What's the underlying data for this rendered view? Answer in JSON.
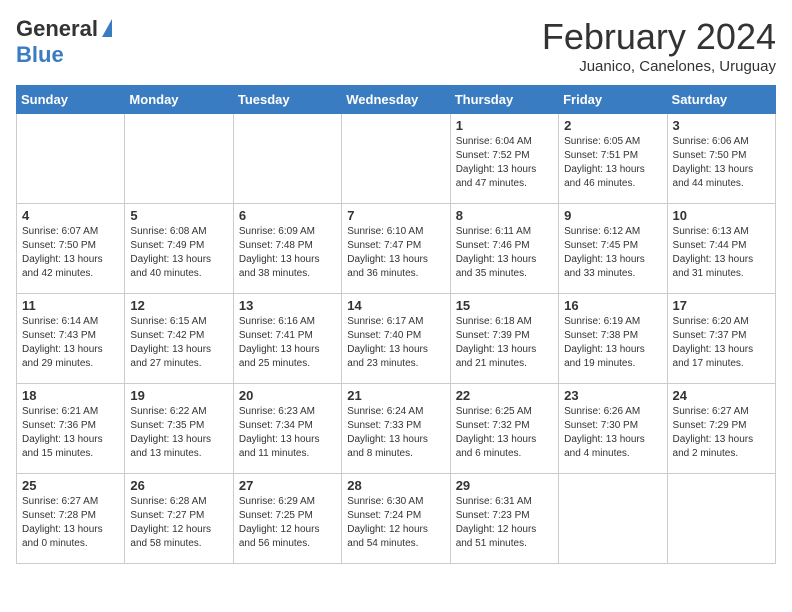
{
  "header": {
    "logo_general": "General",
    "logo_blue": "Blue",
    "month_title": "February 2024",
    "location": "Juanico, Canelones, Uruguay"
  },
  "weekdays": [
    "Sunday",
    "Monday",
    "Tuesday",
    "Wednesday",
    "Thursday",
    "Friday",
    "Saturday"
  ],
  "weeks": [
    [
      {
        "day": "",
        "info": ""
      },
      {
        "day": "",
        "info": ""
      },
      {
        "day": "",
        "info": ""
      },
      {
        "day": "",
        "info": ""
      },
      {
        "day": "1",
        "info": "Sunrise: 6:04 AM\nSunset: 7:52 PM\nDaylight: 13 hours\nand 47 minutes."
      },
      {
        "day": "2",
        "info": "Sunrise: 6:05 AM\nSunset: 7:51 PM\nDaylight: 13 hours\nand 46 minutes."
      },
      {
        "day": "3",
        "info": "Sunrise: 6:06 AM\nSunset: 7:50 PM\nDaylight: 13 hours\nand 44 minutes."
      }
    ],
    [
      {
        "day": "4",
        "info": "Sunrise: 6:07 AM\nSunset: 7:50 PM\nDaylight: 13 hours\nand 42 minutes."
      },
      {
        "day": "5",
        "info": "Sunrise: 6:08 AM\nSunset: 7:49 PM\nDaylight: 13 hours\nand 40 minutes."
      },
      {
        "day": "6",
        "info": "Sunrise: 6:09 AM\nSunset: 7:48 PM\nDaylight: 13 hours\nand 38 minutes."
      },
      {
        "day": "7",
        "info": "Sunrise: 6:10 AM\nSunset: 7:47 PM\nDaylight: 13 hours\nand 36 minutes."
      },
      {
        "day": "8",
        "info": "Sunrise: 6:11 AM\nSunset: 7:46 PM\nDaylight: 13 hours\nand 35 minutes."
      },
      {
        "day": "9",
        "info": "Sunrise: 6:12 AM\nSunset: 7:45 PM\nDaylight: 13 hours\nand 33 minutes."
      },
      {
        "day": "10",
        "info": "Sunrise: 6:13 AM\nSunset: 7:44 PM\nDaylight: 13 hours\nand 31 minutes."
      }
    ],
    [
      {
        "day": "11",
        "info": "Sunrise: 6:14 AM\nSunset: 7:43 PM\nDaylight: 13 hours\nand 29 minutes."
      },
      {
        "day": "12",
        "info": "Sunrise: 6:15 AM\nSunset: 7:42 PM\nDaylight: 13 hours\nand 27 minutes."
      },
      {
        "day": "13",
        "info": "Sunrise: 6:16 AM\nSunset: 7:41 PM\nDaylight: 13 hours\nand 25 minutes."
      },
      {
        "day": "14",
        "info": "Sunrise: 6:17 AM\nSunset: 7:40 PM\nDaylight: 13 hours\nand 23 minutes."
      },
      {
        "day": "15",
        "info": "Sunrise: 6:18 AM\nSunset: 7:39 PM\nDaylight: 13 hours\nand 21 minutes."
      },
      {
        "day": "16",
        "info": "Sunrise: 6:19 AM\nSunset: 7:38 PM\nDaylight: 13 hours\nand 19 minutes."
      },
      {
        "day": "17",
        "info": "Sunrise: 6:20 AM\nSunset: 7:37 PM\nDaylight: 13 hours\nand 17 minutes."
      }
    ],
    [
      {
        "day": "18",
        "info": "Sunrise: 6:21 AM\nSunset: 7:36 PM\nDaylight: 13 hours\nand 15 minutes."
      },
      {
        "day": "19",
        "info": "Sunrise: 6:22 AM\nSunset: 7:35 PM\nDaylight: 13 hours\nand 13 minutes."
      },
      {
        "day": "20",
        "info": "Sunrise: 6:23 AM\nSunset: 7:34 PM\nDaylight: 13 hours\nand 11 minutes."
      },
      {
        "day": "21",
        "info": "Sunrise: 6:24 AM\nSunset: 7:33 PM\nDaylight: 13 hours\nand 8 minutes."
      },
      {
        "day": "22",
        "info": "Sunrise: 6:25 AM\nSunset: 7:32 PM\nDaylight: 13 hours\nand 6 minutes."
      },
      {
        "day": "23",
        "info": "Sunrise: 6:26 AM\nSunset: 7:30 PM\nDaylight: 13 hours\nand 4 minutes."
      },
      {
        "day": "24",
        "info": "Sunrise: 6:27 AM\nSunset: 7:29 PM\nDaylight: 13 hours\nand 2 minutes."
      }
    ],
    [
      {
        "day": "25",
        "info": "Sunrise: 6:27 AM\nSunset: 7:28 PM\nDaylight: 13 hours\nand 0 minutes."
      },
      {
        "day": "26",
        "info": "Sunrise: 6:28 AM\nSunset: 7:27 PM\nDaylight: 12 hours\nand 58 minutes."
      },
      {
        "day": "27",
        "info": "Sunrise: 6:29 AM\nSunset: 7:25 PM\nDaylight: 12 hours\nand 56 minutes."
      },
      {
        "day": "28",
        "info": "Sunrise: 6:30 AM\nSunset: 7:24 PM\nDaylight: 12 hours\nand 54 minutes."
      },
      {
        "day": "29",
        "info": "Sunrise: 6:31 AM\nSunset: 7:23 PM\nDaylight: 12 hours\nand 51 minutes."
      },
      {
        "day": "",
        "info": ""
      },
      {
        "day": "",
        "info": ""
      }
    ]
  ]
}
